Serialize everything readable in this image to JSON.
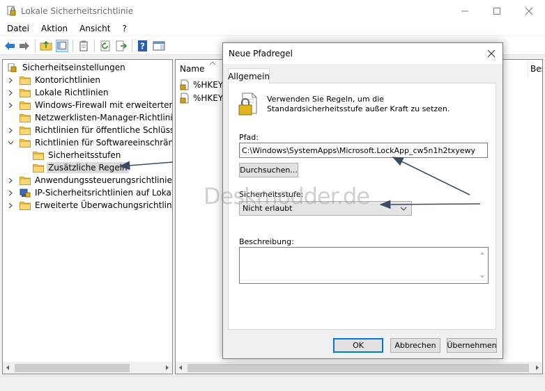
{
  "window": {
    "title": "Lokale Sicherheitsrichtlinie"
  },
  "menu": [
    "Datei",
    "Aktion",
    "Ansicht",
    "?"
  ],
  "tree": {
    "root": "Sicherheitseinstellungen",
    "items": [
      {
        "label": "Kontorichtlinien",
        "expander": "collapsed"
      },
      {
        "label": "Lokale Richtlinien",
        "expander": "collapsed"
      },
      {
        "label": "Windows-Firewall mit erweiterter Sich",
        "expander": "collapsed"
      },
      {
        "label": "Netzwerklisten-Manager-Richtlinien",
        "expander": "none"
      },
      {
        "label": "Richtlinien für öffentliche Schlüssel",
        "expander": "collapsed"
      },
      {
        "label": "Richtlinien für Softwareeinschränkung",
        "expander": "expanded"
      },
      {
        "label": "Sicherheitsstufen",
        "expander": "none"
      },
      {
        "label": "Zusätzliche Regeln",
        "expander": "none",
        "selected": true
      },
      {
        "label": "Anwendungssteuerungsrichtlinien",
        "expander": "collapsed"
      },
      {
        "label": "IP-Sicherheitsrichtlinien auf Lokaler C",
        "expander": "collapsed"
      },
      {
        "label": "Erweiterte Überwachungsrichtlinienko",
        "expander": "collapsed"
      }
    ]
  },
  "list": {
    "columns": [
      "Name",
      "Bes"
    ],
    "rows": [
      "%HKEY_",
      "%HKEY_"
    ]
  },
  "dialog": {
    "title": "Neue Pfadregel",
    "tab": "Allgemein",
    "description": "Verwenden Sie Regeln, um die Standardsicherheitsstufe außer Kraft zu setzen.",
    "path_label": "Pfad:",
    "path_value": "C:\\Windows\\SystemApps\\Microsoft.LockApp_cw5n1h2txyewy",
    "browse_button": "Durchsuchen...",
    "security_label": "Sicherheitsstufe:",
    "security_value": "Nicht erlaubt",
    "description_label": "Beschreibung:",
    "description_value": "",
    "ok": "OK",
    "cancel": "Abbrechen",
    "apply": "Übernehmen"
  },
  "watermark": "Deskmodder.de",
  "colors": {
    "accent": "#0078d7",
    "folder": "#f4c84a",
    "arrow": "#3c4a66"
  }
}
